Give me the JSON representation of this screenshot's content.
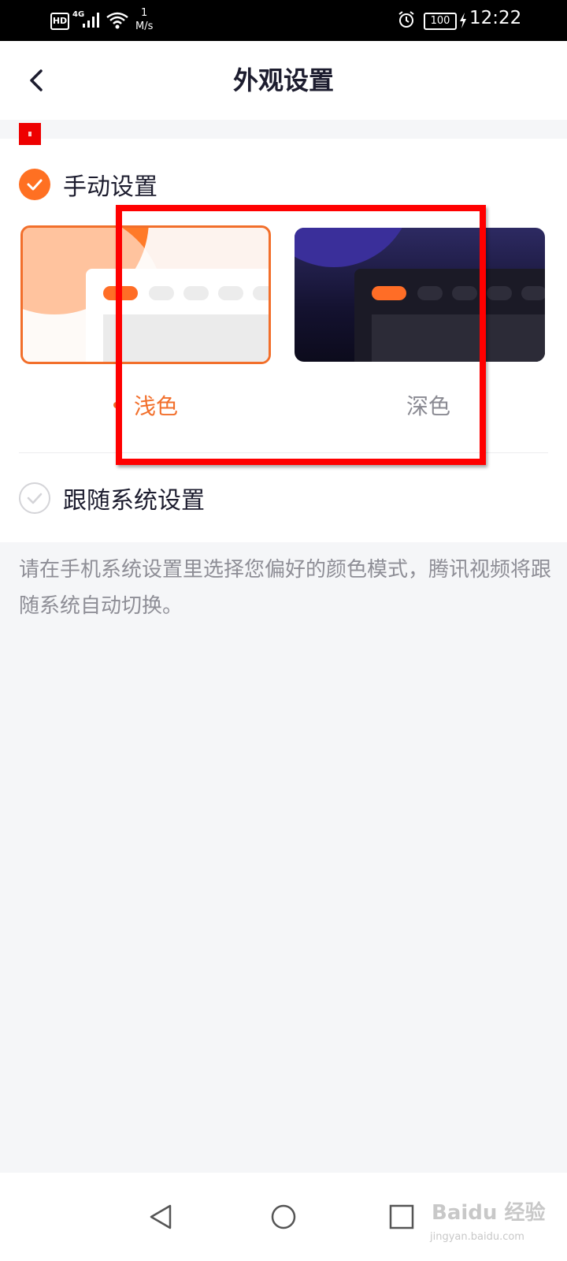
{
  "status_bar": {
    "hd_badge": "HD",
    "network": "4G",
    "speed_value": "1",
    "speed_unit": "M/s",
    "battery": "100",
    "time": "12:22"
  },
  "header": {
    "title": "外观设置"
  },
  "appearance": {
    "manual_label": "手动设置",
    "manual_checked": true,
    "themes": [
      {
        "label": "浅色",
        "selected": true
      },
      {
        "label": "深色",
        "selected": false
      }
    ],
    "follow_system_label": "跟随系统设置",
    "follow_system_checked": false
  },
  "hint": {
    "text": "请在手机系统设置里选择您偏好的颜色模式，腾讯视频将跟随系统自动切换。"
  },
  "watermark": {
    "brand": "Baidu 经验",
    "url": "jingyan.baidu.com"
  },
  "colors": {
    "accent": "#ff7022",
    "annotation": "#ff0000"
  },
  "icons": [
    "hd-icon",
    "signal-icon",
    "wifi-icon",
    "alarm-icon",
    "battery-icon",
    "charging-icon",
    "back-icon",
    "checkmark-icon",
    "nav-back-icon",
    "nav-home-icon",
    "nav-recent-icon"
  ]
}
